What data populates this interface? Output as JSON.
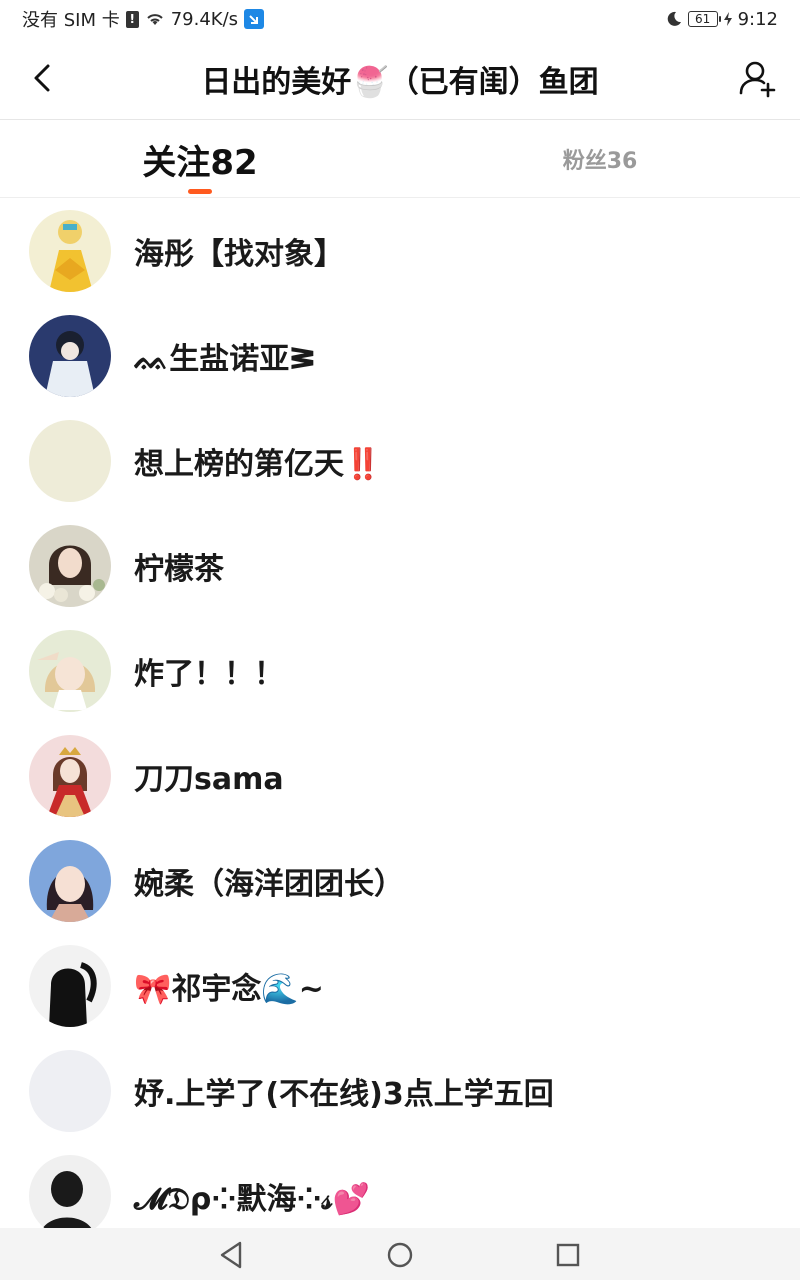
{
  "status_bar": {
    "carrier": "没有 SIM 卡",
    "speed": "79.4K/s",
    "battery": "61",
    "time": "9:12"
  },
  "header": {
    "title": "日出的美好🍧（已有闺）鱼团"
  },
  "tabs": [
    {
      "label": "关注82",
      "active": true
    },
    {
      "label": "粉丝36",
      "active": false
    }
  ],
  "users": [
    {
      "name": "海彤【找对象】",
      "avatar_icon": "yellow-dress-anime-avatar"
    },
    {
      "name": "ᨐ生盐诺亚ᕒ",
      "avatar_icon": "dark-hair-anime-avatar"
    },
    {
      "name": "想上榜的第亿天‼️",
      "avatar_icon": "pale-blank-avatar"
    },
    {
      "name": "柠檬茶",
      "avatar_icon": "girl-with-flowers-avatar"
    },
    {
      "name": "炸了！！！",
      "avatar_icon": "blonde-anime-girl-avatar"
    },
    {
      "name": "刀刀sama",
      "avatar_icon": "red-dress-anime-avatar"
    },
    {
      "name": "婉柔（海洋团团长）",
      "avatar_icon": "blue-bg-anime-girl-avatar"
    },
    {
      "name": "🎀祁宇念🌊~",
      "avatar_icon": "black-silhouette-avatar"
    },
    {
      "name": "妤.上学了(不在线)3点上学五回",
      "avatar_icon": "light-grey-avatar"
    },
    {
      "name": "𝓜𝔇ρ⁘默海⁘𝓈💕",
      "avatar_icon": "dark-silhouette-avatar"
    }
  ],
  "colors": {
    "accent": "#ff5a1f",
    "inactive_tab": "#9a9a9a"
  }
}
